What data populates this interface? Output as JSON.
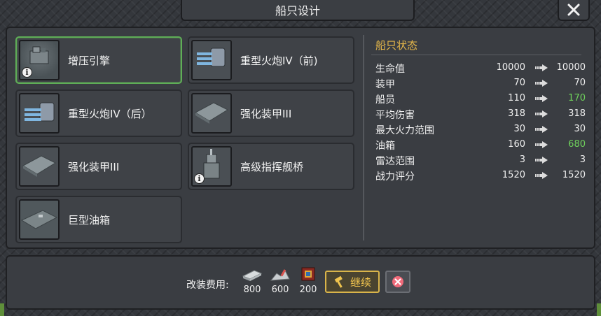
{
  "window": {
    "title": "船只设计"
  },
  "items": [
    {
      "label": "增压引擎",
      "icon": "engine-icon",
      "selected": true,
      "has_info": true
    },
    {
      "label": "重型火炮IV（前)",
      "icon": "heavy-cannon-icon",
      "selected": false,
      "has_info": false
    },
    {
      "label": "重型火炮IV（后）",
      "icon": "heavy-cannon-icon",
      "selected": false,
      "has_info": false
    },
    {
      "label": "强化装甲III",
      "icon": "armor-plate-icon",
      "selected": false,
      "has_info": false
    },
    {
      "label": "强化装甲III",
      "icon": "armor-plate-icon",
      "selected": false,
      "has_info": false
    },
    {
      "label": "高级指挥舰桥",
      "icon": "command-bridge-icon",
      "selected": false,
      "has_info": true
    },
    {
      "label": "巨型油箱",
      "icon": "fuel-tank-icon",
      "selected": false,
      "has_info": false
    }
  ],
  "status": {
    "title": "船只状态",
    "stats": [
      {
        "name": "生命值",
        "before": "10000",
        "after": "10000",
        "increased": false
      },
      {
        "name": "装甲",
        "before": "70",
        "after": "70",
        "increased": false
      },
      {
        "name": "船员",
        "before": "110",
        "after": "170",
        "increased": true
      },
      {
        "name": "平均伤害",
        "before": "318",
        "after": "318",
        "increased": false
      },
      {
        "name": "最大火力范围",
        "before": "30",
        "after": "30",
        "increased": false
      },
      {
        "name": "油箱",
        "before": "160",
        "after": "680",
        "increased": true
      },
      {
        "name": "雷达范围",
        "before": "3",
        "after": "3",
        "increased": false
      },
      {
        "name": "战力评分",
        "before": "1520",
        "after": "1520",
        "increased": false
      }
    ]
  },
  "cost": {
    "label": "改装费用:",
    "resources": [
      {
        "icon": "steel-plate-icon",
        "value": "800"
      },
      {
        "icon": "scrap-metal-icon",
        "value": "600"
      },
      {
        "icon": "microchip-icon",
        "value": "200"
      }
    ]
  },
  "actions": {
    "continue_label": "继续"
  },
  "colors": {
    "accent": "#f0c44e",
    "increase": "#6fd25c",
    "selected_border": "#5fae57",
    "status_title": "#e6b84a"
  }
}
